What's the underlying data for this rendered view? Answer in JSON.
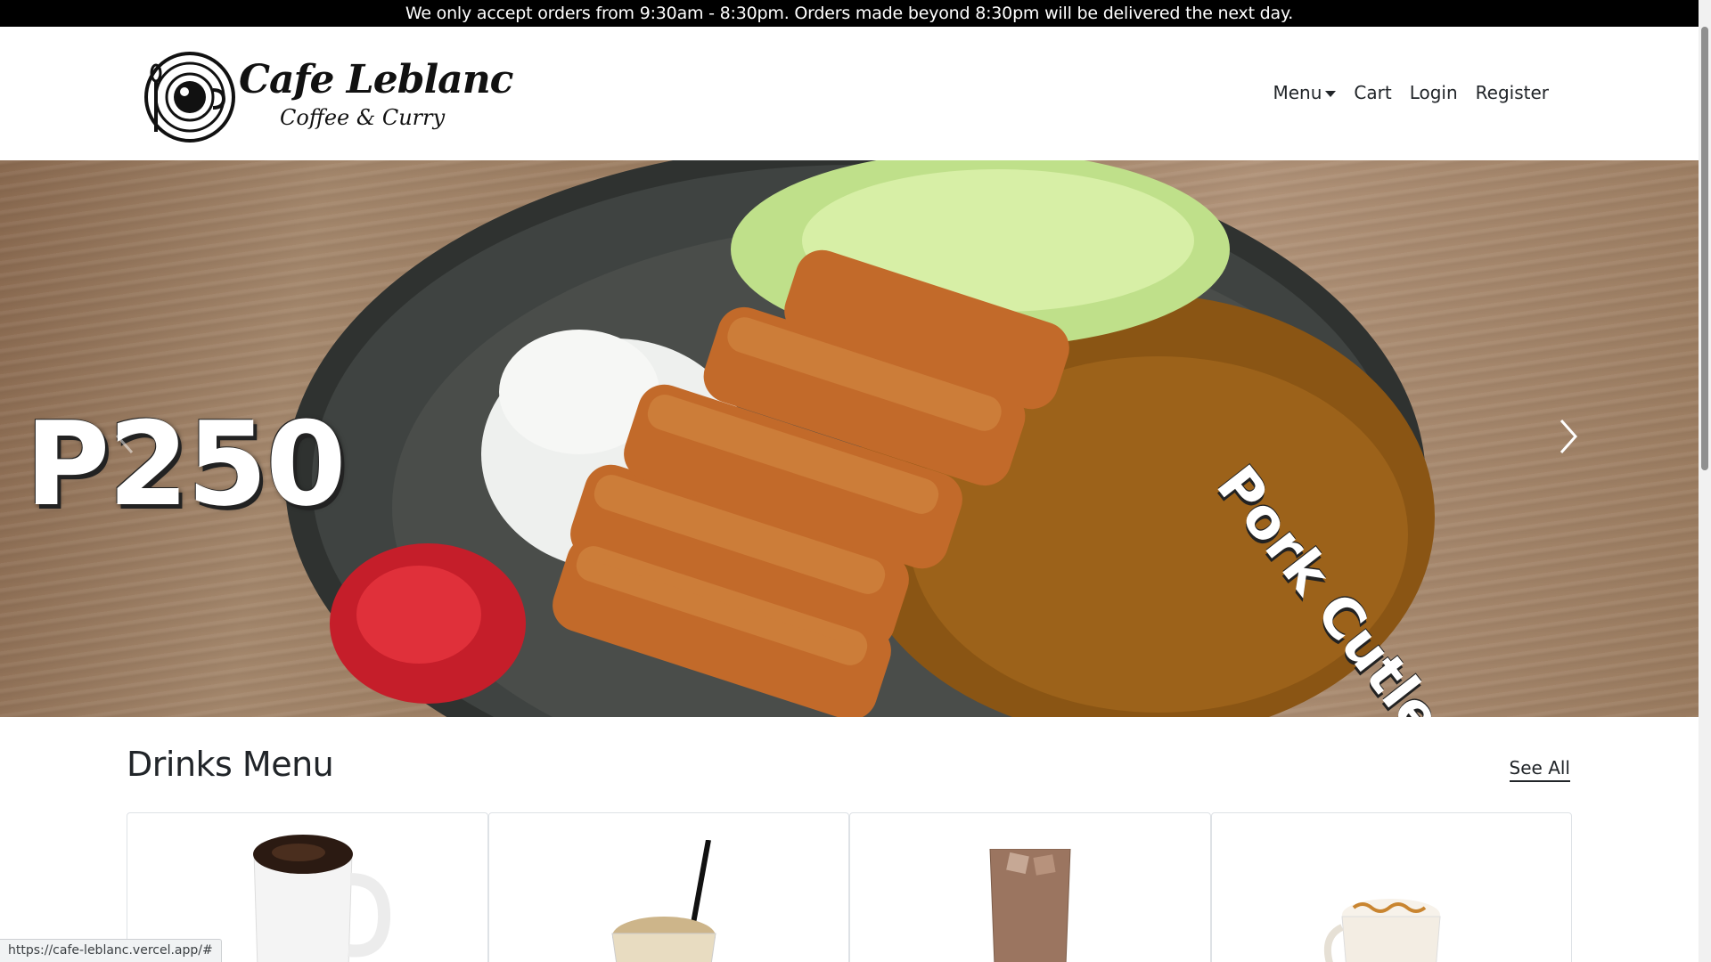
{
  "announcement": "We only accept orders from 9:30am - 8:30pm. Orders made beyond 8:30pm will be delivered the next day.",
  "brand": {
    "name": "Cafe Leblanc",
    "tagline": "Coffee & Curry"
  },
  "nav": {
    "menu": "Menu",
    "cart": "Cart",
    "login": "Login",
    "register": "Register"
  },
  "hero": {
    "price": "P250",
    "dish": "Pork Cutlet Curry"
  },
  "drinks": {
    "title": "Drinks Menu",
    "see_all": "See All",
    "items": [
      {
        "icon": "hot-coffee-mug-image"
      },
      {
        "icon": "frappe-glass-image"
      },
      {
        "icon": "iced-mocha-glass-image"
      },
      {
        "icon": "caramel-latte-mug-image"
      }
    ]
  },
  "status_url": "https://cafe-leblanc.vercel.app/#",
  "colors": {
    "announcement_bg": "#000000",
    "accent_text": "#212529"
  }
}
